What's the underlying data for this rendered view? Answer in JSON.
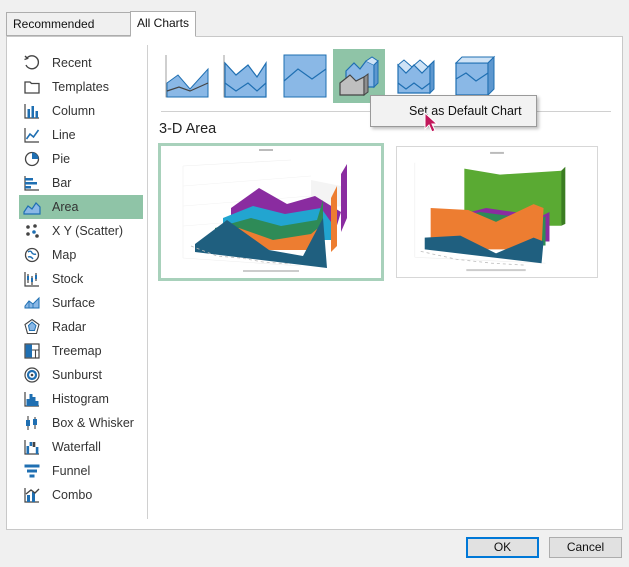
{
  "tabs": [
    {
      "label": "Recommended Charts",
      "active": false
    },
    {
      "label": "All Charts",
      "active": true
    }
  ],
  "sidebar": {
    "selected": "Area",
    "items": [
      {
        "label": "Recent",
        "icon": "recent-icon"
      },
      {
        "label": "Templates",
        "icon": "templates-icon"
      },
      {
        "label": "Column",
        "icon": "column-chart-icon"
      },
      {
        "label": "Line",
        "icon": "line-chart-icon"
      },
      {
        "label": "Pie",
        "icon": "pie-chart-icon"
      },
      {
        "label": "Bar",
        "icon": "bar-chart-icon"
      },
      {
        "label": "Area",
        "icon": "area-chart-icon"
      },
      {
        "label": "X Y (Scatter)",
        "icon": "scatter-chart-icon"
      },
      {
        "label": "Map",
        "icon": "map-chart-icon"
      },
      {
        "label": "Stock",
        "icon": "stock-chart-icon"
      },
      {
        "label": "Surface",
        "icon": "surface-chart-icon"
      },
      {
        "label": "Radar",
        "icon": "radar-chart-icon"
      },
      {
        "label": "Treemap",
        "icon": "treemap-chart-icon"
      },
      {
        "label": "Sunburst",
        "icon": "sunburst-chart-icon"
      },
      {
        "label": "Histogram",
        "icon": "histogram-chart-icon"
      },
      {
        "label": "Box & Whisker",
        "icon": "box-whisker-chart-icon"
      },
      {
        "label": "Waterfall",
        "icon": "waterfall-chart-icon"
      },
      {
        "label": "Funnel",
        "icon": "funnel-chart-icon"
      },
      {
        "label": "Combo",
        "icon": "combo-chart-icon"
      }
    ]
  },
  "subtypes": [
    {
      "name": "area",
      "selected": false
    },
    {
      "name": "stacked-area",
      "selected": false
    },
    {
      "name": "100-percent-stacked-area",
      "selected": false
    },
    {
      "name": "3d-area",
      "selected": true
    },
    {
      "name": "3d-stacked-area",
      "selected": false
    },
    {
      "name": "3d-100-percent-stacked-area",
      "selected": false
    }
  ],
  "section_title": "3-D Area",
  "context_menu": {
    "items": [
      {
        "label": "Set as Default Chart"
      }
    ]
  },
  "previews": [
    {
      "name": "3d-area-preview-1",
      "selected": true
    },
    {
      "name": "3d-area-preview-2",
      "selected": false
    }
  ],
  "colors": {
    "selection": "#8fc4a7",
    "preview_border_selected": "#a8d1bb",
    "icon_blue": "#1f6fb2",
    "thumb_fill": "#8ab8e6",
    "series": [
      "#1f5f7f",
      "#ed7d31",
      "#2e8b57",
      "#22a5d0",
      "#8a2ca0",
      "#5aaa33"
    ]
  },
  "buttons": {
    "ok": "OK",
    "cancel": "Cancel"
  }
}
